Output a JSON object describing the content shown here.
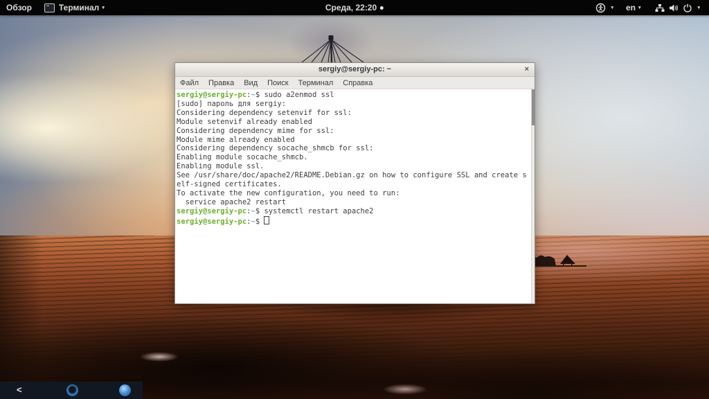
{
  "top_bar": {
    "activities_label": "Обзор",
    "app_menu": {
      "label": "Терминал"
    },
    "caret": "▾",
    "clock": "Среда, 22:20",
    "keyboard_layout": "en"
  },
  "window": {
    "title": "sergiy@sergiy-pc: ~",
    "close_label": "×",
    "menu_items": [
      "Файл",
      "Правка",
      "Вид",
      "Поиск",
      "Терминал",
      "Справка"
    ],
    "terminal": {
      "prompt_user": "sergiy@sergiy-pc",
      "prompt_sep": ":",
      "prompt_path": "~",
      "prompt_symbol": "$",
      "lines": [
        {
          "type": "prompt",
          "command": "sudo a2enmod ssl"
        },
        {
          "type": "output",
          "text": "[sudo] пароль для sergiy: "
        },
        {
          "type": "output",
          "text": "Considering dependency setenvif for ssl:"
        },
        {
          "type": "output",
          "text": "Module setenvif already enabled"
        },
        {
          "type": "output",
          "text": "Considering dependency mime for ssl:"
        },
        {
          "type": "output",
          "text": "Module mime already enabled"
        },
        {
          "type": "output",
          "text": "Considering dependency socache_shmcb for ssl:"
        },
        {
          "type": "output",
          "text": "Enabling module socache_shmcb."
        },
        {
          "type": "output",
          "text": "Enabling module ssl."
        },
        {
          "type": "output",
          "text": "See /usr/share/doc/apache2/README.Debian.gz on how to configure SSL and create s"
        },
        {
          "type": "output",
          "text": "elf-signed certificates."
        },
        {
          "type": "output",
          "text": "To activate the new configuration, you need to run:"
        },
        {
          "type": "output",
          "text": "  service apache2 restart"
        },
        {
          "type": "prompt",
          "command": "systemctl restart apache2"
        },
        {
          "type": "prompt",
          "command": "",
          "cursor": true
        }
      ]
    }
  },
  "dock": {
    "chevron": "<"
  },
  "colors": {
    "prompt_green": "#6ab02f",
    "prompt_path_teal": "#45a39b",
    "terminal_text": "#3d3d3d",
    "terminal_bg": "#ffffff",
    "top_bar_bg": "#050505"
  }
}
